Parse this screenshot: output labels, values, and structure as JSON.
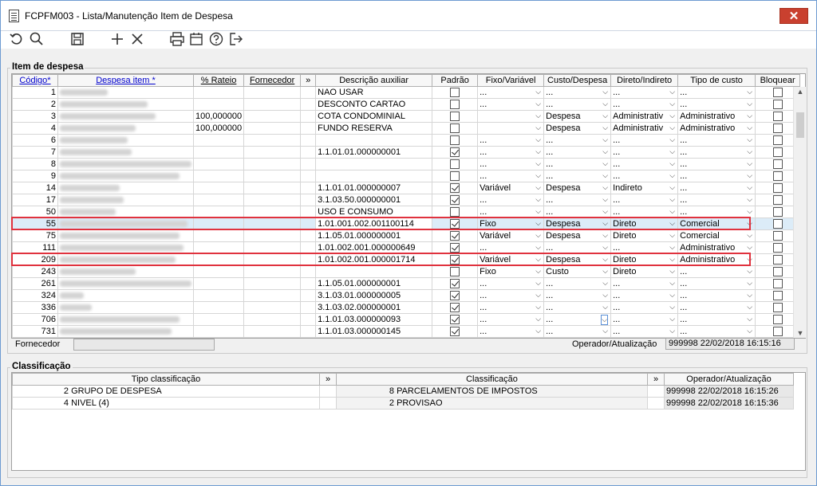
{
  "window": {
    "title": "FCPFM003 - Lista/Manutenção Item de Despesa",
    "close_label": "✕"
  },
  "toolbar": {
    "icons": [
      "undo-icon",
      "search-icon",
      "save-icon",
      "add-icon",
      "delete-icon",
      "print-icon",
      "calendar-icon",
      "help-icon",
      "exit-icon"
    ]
  },
  "item_panel": {
    "title": "Item de despesa",
    "headers": {
      "codigo": "Código*",
      "despesa": "Despesa item *",
      "rateio": "% Rateio",
      "fornecedor": "Fornecedor",
      "more": "»",
      "descricao": "Descrição auxiliar",
      "padrao": "Padrão",
      "fixo": "Fixo/Variável",
      "custo": "Custo/Despesa",
      "direto": "Direto/Indireto",
      "tipo": "Tipo de custo",
      "bloquear": "Bloquear"
    },
    "rows": [
      {
        "code": "1",
        "rateio": "",
        "desc": "NAO USAR",
        "padrao": false,
        "fixo": "...",
        "custo": "...",
        "direto": "...",
        "tipo": "..."
      },
      {
        "code": "2",
        "rateio": "",
        "desc": "DESCONTO CARTAO",
        "padrao": false,
        "fixo": "...",
        "custo": "...",
        "direto": "...",
        "tipo": "..."
      },
      {
        "code": "3",
        "rateio": "100,000000",
        "desc": "COTA CONDOMINIAL",
        "padrao": false,
        "fixo": "",
        "custo": "Despesa",
        "direto": "Administrativ",
        "tipo": "Administrativo"
      },
      {
        "code": "4",
        "rateio": "100,000000",
        "desc": "FUNDO RESERVA",
        "padrao": false,
        "fixo": "",
        "custo": "Despesa",
        "direto": "Administrativ",
        "tipo": "Administrativo"
      },
      {
        "code": "6",
        "rateio": "",
        "desc": "",
        "padrao": false,
        "fixo": "...",
        "custo": "...",
        "direto": "...",
        "tipo": "..."
      },
      {
        "code": "7",
        "rateio": "",
        "desc": "1.1.01.01.000000001",
        "padrao": true,
        "fixo": "...",
        "custo": "...",
        "direto": "...",
        "tipo": "..."
      },
      {
        "code": "8",
        "rateio": "",
        "desc": "",
        "padrao": false,
        "fixo": "...",
        "custo": "...",
        "direto": "...",
        "tipo": "..."
      },
      {
        "code": "9",
        "rateio": "",
        "desc": "",
        "padrao": false,
        "fixo": "...",
        "custo": "...",
        "direto": "...",
        "tipo": "..."
      },
      {
        "code": "14",
        "rateio": "",
        "desc": "1.1.01.01.000000007",
        "padrao": true,
        "fixo": "Variável",
        "custo": "Despesa",
        "direto": "Indireto",
        "tipo": "..."
      },
      {
        "code": "17",
        "rateio": "",
        "desc": "3.1.03.50.000000001",
        "padrao": true,
        "fixo": "...",
        "custo": "...",
        "direto": "...",
        "tipo": "..."
      },
      {
        "code": "50",
        "rateio": "",
        "desc": "USO E CONSUMO",
        "padrao": false,
        "fixo": "...",
        "custo": "...",
        "direto": "...",
        "tipo": "..."
      },
      {
        "code": "55",
        "rateio": "",
        "desc": "1.01.001.002.001100114",
        "padrao": true,
        "fixo": "Fixo",
        "custo": "Despesa",
        "direto": "Direto",
        "tipo": "Comercial"
      },
      {
        "code": "75",
        "rateio": "",
        "desc": "1.1.05.01.000000001",
        "padrao": true,
        "fixo": "Variável",
        "custo": "Despesa",
        "direto": "Direto",
        "tipo": "Comercial"
      },
      {
        "code": "111",
        "rateio": "",
        "desc": "1.01.002.001.000000649",
        "padrao": true,
        "fixo": "...",
        "custo": "...",
        "direto": "...",
        "tipo": "Administrativo"
      },
      {
        "code": "209",
        "rateio": "",
        "desc": "1.01.002.001.000001714",
        "padrao": true,
        "fixo": "Variável",
        "custo": "Despesa",
        "direto": "Direto",
        "tipo": "Administrativo"
      },
      {
        "code": "243",
        "rateio": "",
        "desc": "",
        "padrao": false,
        "fixo": "Fixo",
        "custo": "Custo",
        "direto": "Direto",
        "tipo": "..."
      },
      {
        "code": "261",
        "rateio": "",
        "desc": "1.1.05.01.000000001",
        "padrao": true,
        "fixo": "...",
        "custo": "...",
        "direto": "...",
        "tipo": "..."
      },
      {
        "code": "324",
        "rateio": "",
        "desc": "3.1.03.01.000000005",
        "padrao": true,
        "fixo": "...",
        "custo": "...",
        "direto": "...",
        "tipo": "..."
      },
      {
        "code": "336",
        "rateio": "",
        "desc": "3.1.03.02.000000001",
        "padrao": true,
        "fixo": "...",
        "custo": "...",
        "direto": "...",
        "tipo": "..."
      },
      {
        "code": "706",
        "rateio": "",
        "desc": "1.1.01.03.000000093",
        "padrao": true,
        "fixo": "...",
        "custo": "...",
        "direto": "...",
        "tipo": "..."
      },
      {
        "code": "731",
        "rateio": "",
        "desc": "1.1.01.03.000000145",
        "padrao": true,
        "fixo": "...",
        "custo": "...",
        "direto": "...",
        "tipo": "..."
      }
    ],
    "fornecedor_label": "Fornecedor",
    "operador_label": "Operador/Atualização",
    "operador_value": "999998  22/02/2018 16:15:16"
  },
  "class_panel": {
    "title": "Classificação",
    "headers": {
      "tipo": "Tipo classificação",
      "more1": "»",
      "classificacao": "Classificação",
      "more2": "»",
      "operador": "Operador/Atualização"
    },
    "rows": [
      {
        "tipo_code": "2",
        "tipo_name": "GRUPO DE DESPESA",
        "class_code": "8",
        "class_name": "PARCELAMENTOS DE IMPOSTOS",
        "operador": "999998",
        "date": "22/02/2018 16:15:26"
      },
      {
        "tipo_code": "4",
        "tipo_name": "NIVEL (4)",
        "class_code": "2",
        "class_name": "PROVISAO",
        "operador": "999998",
        "date": "22/02/2018 16:15:36"
      }
    ]
  },
  "colors": {
    "highlight_border": "#e0323e",
    "close_button": "#c9402f",
    "selected_row": "#dcecf8"
  }
}
